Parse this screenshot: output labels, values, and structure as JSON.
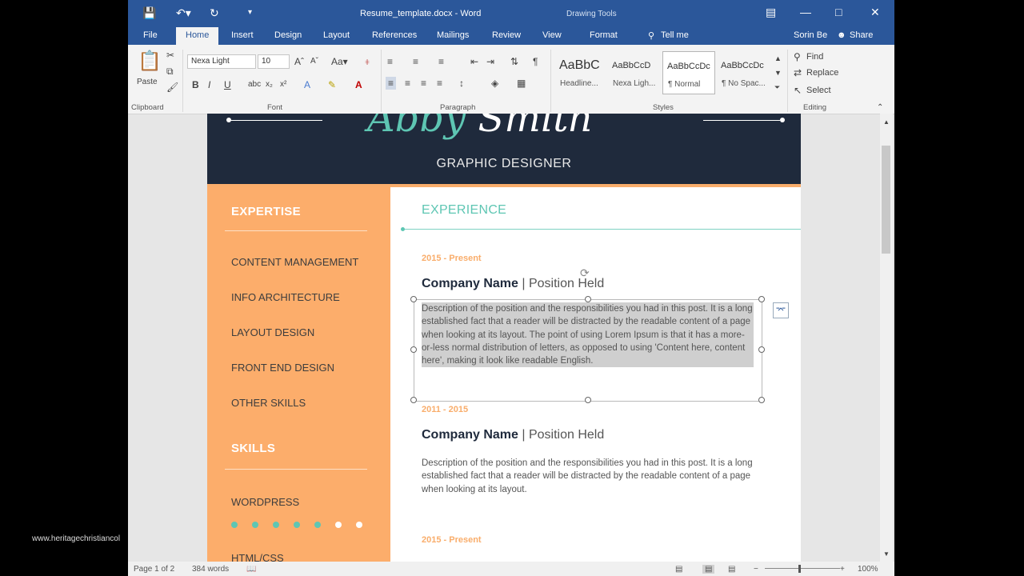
{
  "window": {
    "doc_title": "Resume_template.docx - Word",
    "context_tools": "Drawing Tools",
    "tell_me": "Tell me",
    "user": "Sorin Be",
    "share": "Share"
  },
  "tabs": [
    "File",
    "Home",
    "Insert",
    "Design",
    "Layout",
    "References",
    "Mailings",
    "Review",
    "View",
    "Format"
  ],
  "ribbon": {
    "paste": "Paste",
    "font_name": "Nexa Light",
    "font_size": "10",
    "styles": [
      {
        "preview": "AaBbC",
        "name": "Headline..."
      },
      {
        "preview": "AaBbCcD",
        "name": "Nexa Ligh..."
      },
      {
        "preview": "AaBbCcDc",
        "name": "¶ Normal"
      },
      {
        "preview": "AaBbCcDc",
        "name": "¶ No Spac..."
      }
    ],
    "find": "Find",
    "replace": "Replace",
    "select": "Select",
    "groups": {
      "clipboard": "Clipboard",
      "font": "Font",
      "paragraph": "Paragraph",
      "styles": "Styles",
      "editing": "Editing"
    }
  },
  "resume": {
    "first_name": "Abby",
    "last_name": "Smith",
    "role": "GRAPHIC DESIGNER",
    "expertise_heading": "EXPERTISE",
    "expertise": [
      "CONTENT MANAGEMENT",
      "INFO ARCHITECTURE",
      "LAYOUT DESIGN",
      "FRONT END DESIGN",
      "OTHER SKILLS"
    ],
    "skills_heading": "SKILLS",
    "skills": [
      {
        "name": "WORDPRESS",
        "rating": 5,
        "max": 7
      },
      {
        "name": "HTML/CSS"
      }
    ],
    "experience_heading": "EXPERIENCE",
    "jobs": [
      {
        "date": "2015 - Present",
        "company": "Company Name",
        "position": "| Position Held",
        "desc": "Description of the position and the responsibilities you had in this post. It is a long established fact that a reader will be distracted by the readable content of a page when looking at its layout. The point of using Lorem Ipsum is that it has a more-or-less normal distribution of letters, as opposed to using 'Content here, content here', making it look like readable English."
      },
      {
        "date": "2011 - 2015",
        "company": "Company Name",
        "position": "| Position Held",
        "desc": "Description of the position and the responsibilities you had in this post. It is a long established fact that a reader will be distracted by the readable content of a page when looking at its layout."
      },
      {
        "date": "2015 - Present"
      }
    ]
  },
  "status": {
    "page": "Page 1 of 2",
    "words": "384 words",
    "zoom": "100%"
  },
  "watermark": "www.heritagechristiancol",
  "colors": {
    "title_bar": "#2b579a",
    "header_band": "#1f2a3c",
    "accent_teal": "#5ec6b3",
    "accent_orange": "#fcad6b",
    "skill_on": "#5ec6b3",
    "skill_off": "#ffffff"
  }
}
